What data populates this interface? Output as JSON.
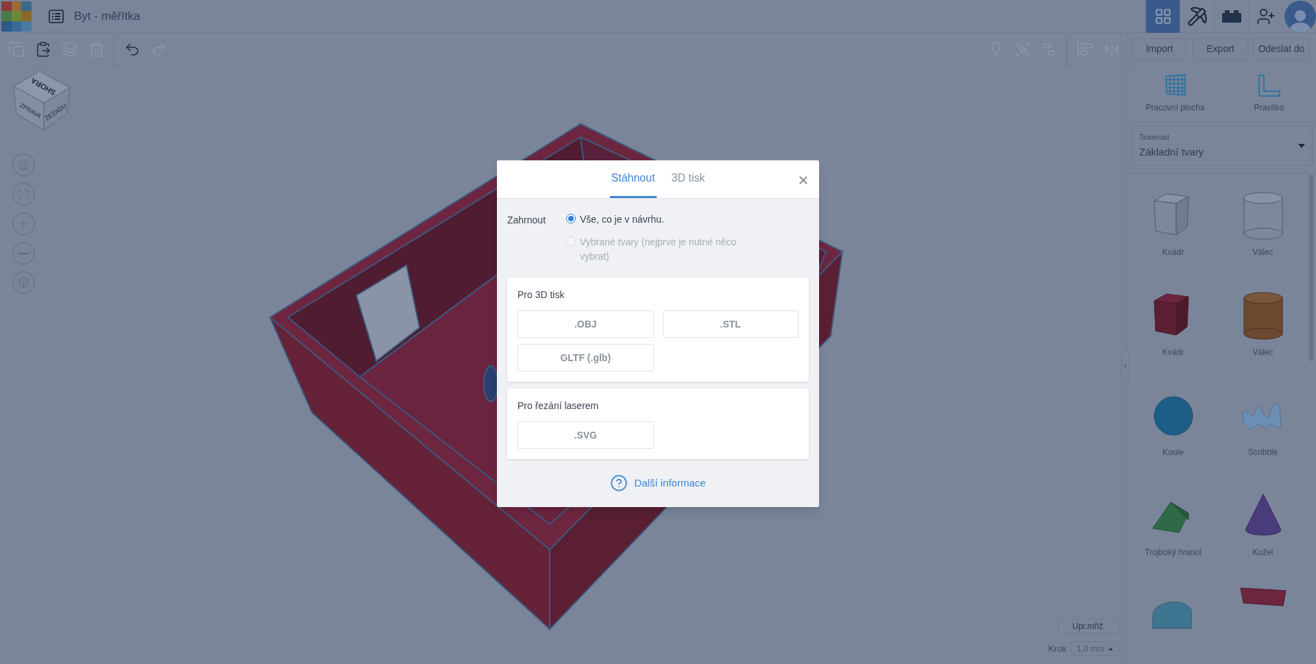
{
  "app": {
    "title": "Byt - měřítka"
  },
  "header_tools": [
    {
      "kind": "grid",
      "selected": true
    },
    {
      "kind": "pickaxe",
      "selected": false
    },
    {
      "kind": "bricks",
      "selected": false
    },
    {
      "kind": "add-user",
      "selected": false
    }
  ],
  "toolbar": [
    {
      "kind": "copy",
      "disabled": true
    },
    {
      "kind": "paste",
      "disabled": false
    },
    {
      "kind": "duplicate",
      "disabled": true
    },
    {
      "kind": "delete",
      "disabled": true
    },
    {
      "kind": "divider"
    },
    {
      "kind": "undo",
      "disabled": false
    },
    {
      "kind": "redo",
      "disabled": true
    }
  ],
  "toolbar_right": [
    {
      "kind": "light",
      "disabled": true
    },
    {
      "kind": "group",
      "disabled": true
    },
    {
      "kind": "ungroup",
      "disabled": true
    },
    {
      "kind": "divider"
    },
    {
      "kind": "align",
      "disabled": true
    },
    {
      "kind": "mirror",
      "disabled": true
    }
  ],
  "panel_buttons": [
    "Import",
    "Export",
    "Odeslat do"
  ],
  "panel_tools": [
    {
      "kind": "workplane",
      "label": "Pracovní plocha"
    },
    {
      "kind": "ruler",
      "label": "Pravítko"
    }
  ],
  "library": {
    "label": "Tinkercad",
    "value": "Základní tvary"
  },
  "shapes": [
    {
      "kind": "hole-box",
      "label": "Kvádr"
    },
    {
      "kind": "hole-cylinder",
      "label": "Válec"
    },
    {
      "kind": "box",
      "label": "Kvádr"
    },
    {
      "kind": "cylinder",
      "label": "Válec"
    },
    {
      "kind": "sphere",
      "label": "Koule"
    },
    {
      "kind": "scribble",
      "label": "Scribble"
    },
    {
      "kind": "prism",
      "label": "Trojboký hranol"
    },
    {
      "kind": "cone",
      "label": "Kužel"
    },
    {
      "kind": "roof"
    },
    {
      "kind": "text3d"
    }
  ],
  "viewcube": [
    "SHORA",
    "ZPRAVA",
    "ZEZADU"
  ],
  "grid_controls": {
    "edit_button": "Upr.mřiž.",
    "step_label": "Krok",
    "step_value": "1,0 mm"
  },
  "dialog": {
    "tabs": [
      {
        "label": "Stáhnout",
        "selected": true
      },
      {
        "label": "3D tisk",
        "selected": false
      }
    ],
    "include_label": "Zahrnout",
    "options": [
      {
        "label": "Vše, co je v návrhu.",
        "selected": true,
        "disabled": false
      },
      {
        "label": "Vybrané tvary (nejprve je nutné něco vybrat)",
        "selected": false,
        "disabled": true
      }
    ],
    "sections": [
      {
        "title": "Pro 3D tisk",
        "buttons": [
          ".OBJ",
          ".STL",
          "GLTF (.glb)"
        ]
      },
      {
        "title": "Pro řezání laserem",
        "buttons": [
          ".SVG"
        ]
      }
    ],
    "help_link": "Další informace"
  }
}
